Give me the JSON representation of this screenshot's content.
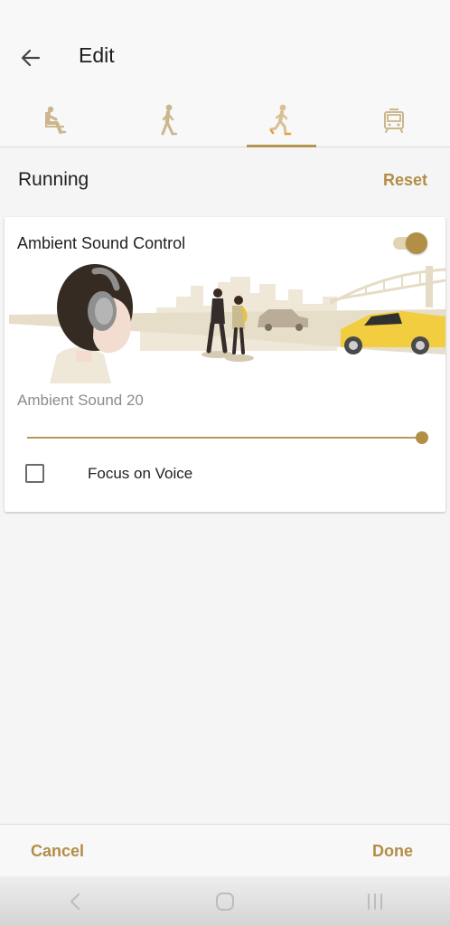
{
  "header": {
    "title": "Edit"
  },
  "tabs": [
    {
      "icon": "sitting-person-icon",
      "selected": false
    },
    {
      "icon": "walking-person-icon",
      "selected": false
    },
    {
      "icon": "running-person-icon",
      "selected": true
    },
    {
      "icon": "train-icon",
      "selected": false
    }
  ],
  "section": {
    "title": "Running",
    "reset_label": "Reset"
  },
  "card": {
    "ambient_control_label": "Ambient Sound Control",
    "ambient_control_on": true,
    "ambient_level_label": "Ambient Sound 20",
    "ambient_level_fraction": 1.0,
    "focus_voice_label": "Focus on Voice",
    "focus_voice_checked": false
  },
  "footer": {
    "cancel_label": "Cancel",
    "done_label": "Done"
  },
  "colors": {
    "accent": "#b18f47",
    "accent_light": "#e2d4b3",
    "background": "#f5f5f5",
    "card": "#ffffff"
  },
  "system_nav": {
    "icons": [
      "nav-back-icon",
      "nav-home-icon",
      "nav-recents-icon"
    ]
  }
}
